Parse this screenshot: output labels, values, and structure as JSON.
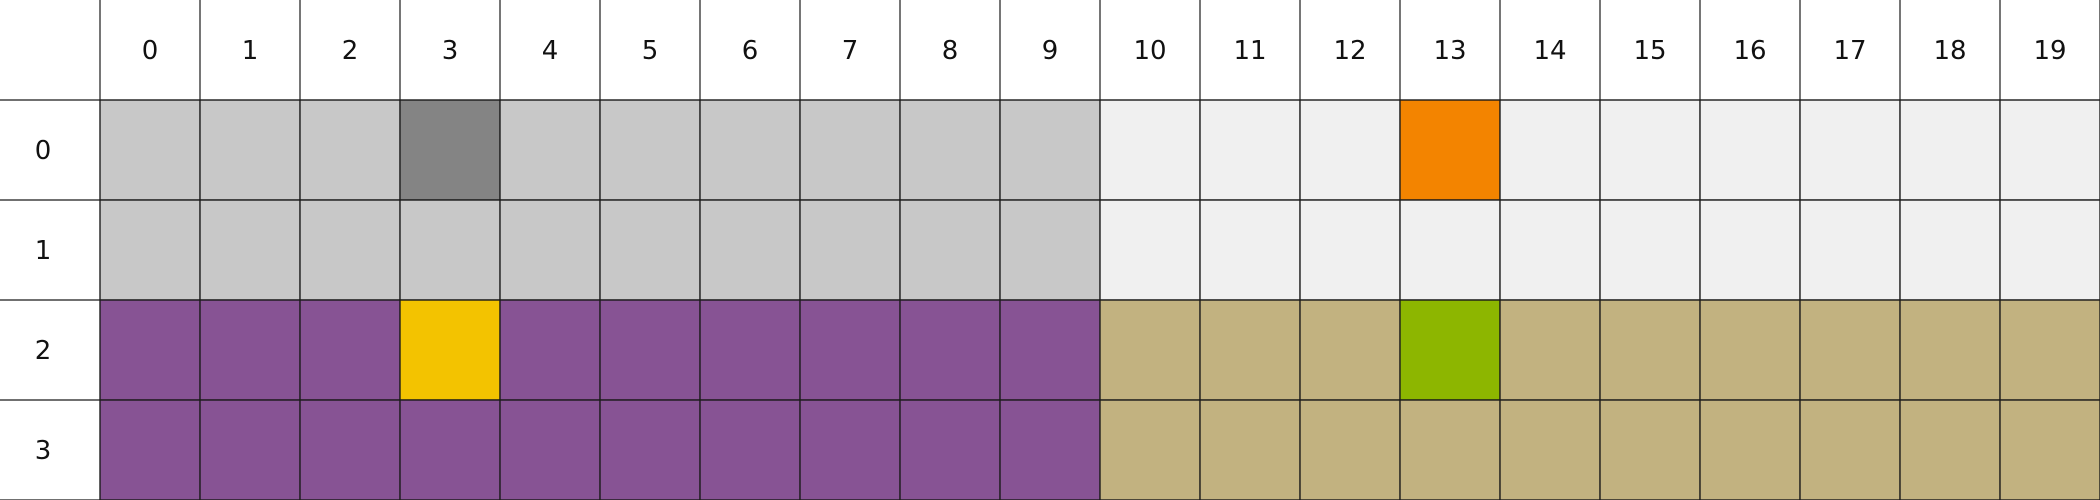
{
  "columns": [
    "0",
    "1",
    "2",
    "3",
    "4",
    "5",
    "6",
    "7",
    "8",
    "9",
    "10",
    "11",
    "12",
    "13",
    "14",
    "15",
    "16",
    "17",
    "18",
    "19"
  ],
  "rows": [
    "0",
    "1",
    "2",
    "3"
  ],
  "palette": {
    "A": "#c8c8c8",
    "B": "#f0f0f0",
    "C": "#875394",
    "D": "#c2b280",
    "E": "#848484",
    "F": "#f38400",
    "G": "#f3c300",
    "H": "#8db600"
  },
  "cells": [
    [
      "A",
      "A",
      "A",
      "E",
      "A",
      "A",
      "A",
      "A",
      "A",
      "A",
      "B",
      "B",
      "B",
      "F",
      "B",
      "B",
      "B",
      "B",
      "B",
      "B"
    ],
    [
      "A",
      "A",
      "A",
      "A",
      "A",
      "A",
      "A",
      "A",
      "A",
      "A",
      "B",
      "B",
      "B",
      "B",
      "B",
      "B",
      "B",
      "B",
      "B",
      "B"
    ],
    [
      "C",
      "C",
      "C",
      "G",
      "C",
      "C",
      "C",
      "C",
      "C",
      "C",
      "D",
      "D",
      "D",
      "H",
      "D",
      "D",
      "D",
      "D",
      "D",
      "D"
    ],
    [
      "C",
      "C",
      "C",
      "C",
      "C",
      "C",
      "C",
      "C",
      "C",
      "C",
      "D",
      "D",
      "D",
      "D",
      "D",
      "D",
      "D",
      "D",
      "D",
      "D"
    ]
  ]
}
